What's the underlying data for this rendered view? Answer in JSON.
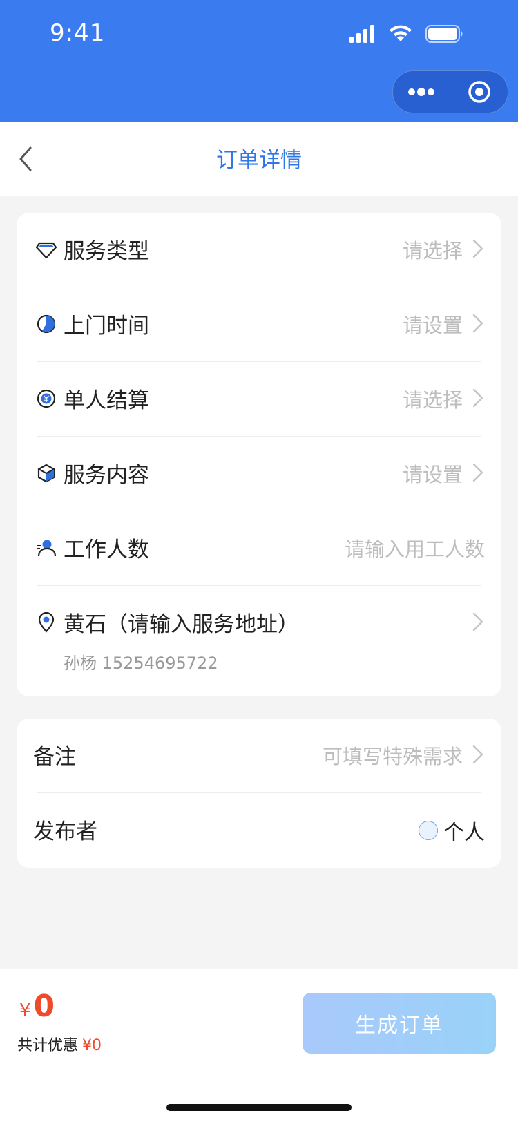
{
  "status_bar": {
    "time": "9:41"
  },
  "nav": {
    "title": "订单详情"
  },
  "form": {
    "rows": [
      {
        "label": "服务类型",
        "value": "请选择",
        "icon": "diamond-icon"
      },
      {
        "label": "上门时间",
        "value": "请设置",
        "icon": "clock-icon"
      },
      {
        "label": "单人结算",
        "value": "请选择",
        "icon": "yen-coin-icon"
      },
      {
        "label": "服务内容",
        "value": "请设置",
        "icon": "box-icon"
      },
      {
        "label": "工作人数",
        "placeholder": "请输入用工人数",
        "icon": "person-icon"
      }
    ],
    "address": {
      "title": "黄石（请输入服务地址）",
      "contact": "孙杨 15254695722",
      "icon": "location-pin-icon"
    }
  },
  "extra": {
    "remark_label": "备注",
    "remark_placeholder": "可填写特殊需求",
    "publisher_label": "发布者",
    "publisher_option": "个人"
  },
  "footer": {
    "currency": "¥",
    "total": "0",
    "discount_label": "共计优惠",
    "discount_amount": "¥0",
    "submit_label": "生成订单"
  },
  "colors": {
    "brand_blue": "#3a7cf0",
    "title_blue": "#2f76e6",
    "price_red": "#ef4a2a",
    "button_gradient": [
      "#a9c9fb",
      "#99d2f8"
    ]
  }
}
